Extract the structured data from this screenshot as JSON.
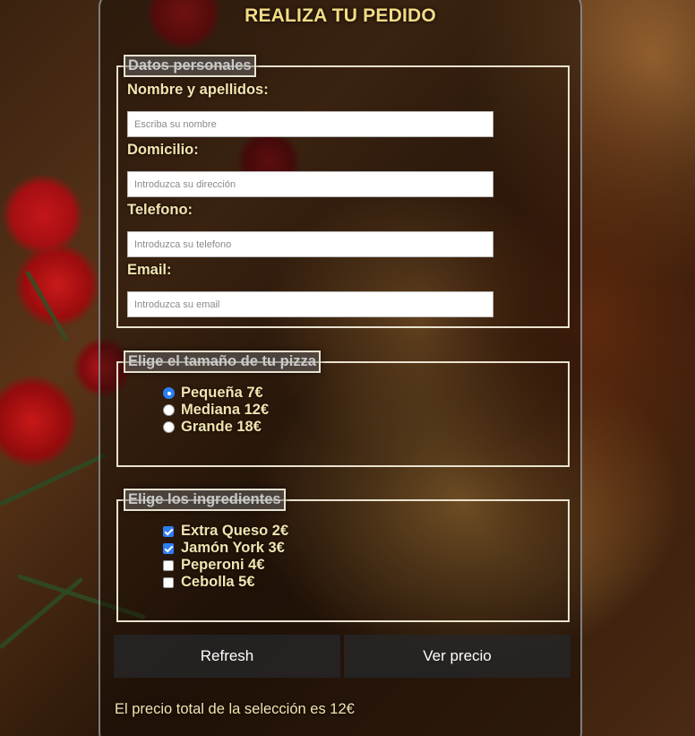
{
  "form": {
    "title": "REALIZA TU PEDIDO"
  },
  "personal": {
    "legend": "Datos personales",
    "name_label": "Nombre y apellidos:",
    "name_placeholder": "Escriba su nombre",
    "address_label": "Domicilio:",
    "address_placeholder": "Introduzca su dirección",
    "phone_label": "Telefono:",
    "phone_placeholder": "Introduzca su telefono",
    "email_label": "Email:",
    "email_placeholder": "Introduzca su email"
  },
  "size": {
    "legend": "Elige el tamaño de tu pizza",
    "options": [
      {
        "label": "Pequeña 7€",
        "checked": true
      },
      {
        "label": "Mediana 12€",
        "checked": false
      },
      {
        "label": "Grande 18€",
        "checked": false
      }
    ]
  },
  "ingredients": {
    "legend": "Elige los ingredientes",
    "options": [
      {
        "label": "Extra Queso 2€",
        "checked": true
      },
      {
        "label": "Jamón York 3€",
        "checked": true
      },
      {
        "label": "Peperoni 4€",
        "checked": false
      },
      {
        "label": "Cebolla 5€",
        "checked": false
      }
    ]
  },
  "actions": {
    "refresh_label": "Refresh",
    "price_label": "Ver precio"
  },
  "result": {
    "text": "El precio total de la selección es 12€"
  },
  "colors": {
    "title": "#f3dc85",
    "label_text": "#f3e4b0",
    "accent": "#2d7ef5",
    "button_bg": "#262626"
  }
}
